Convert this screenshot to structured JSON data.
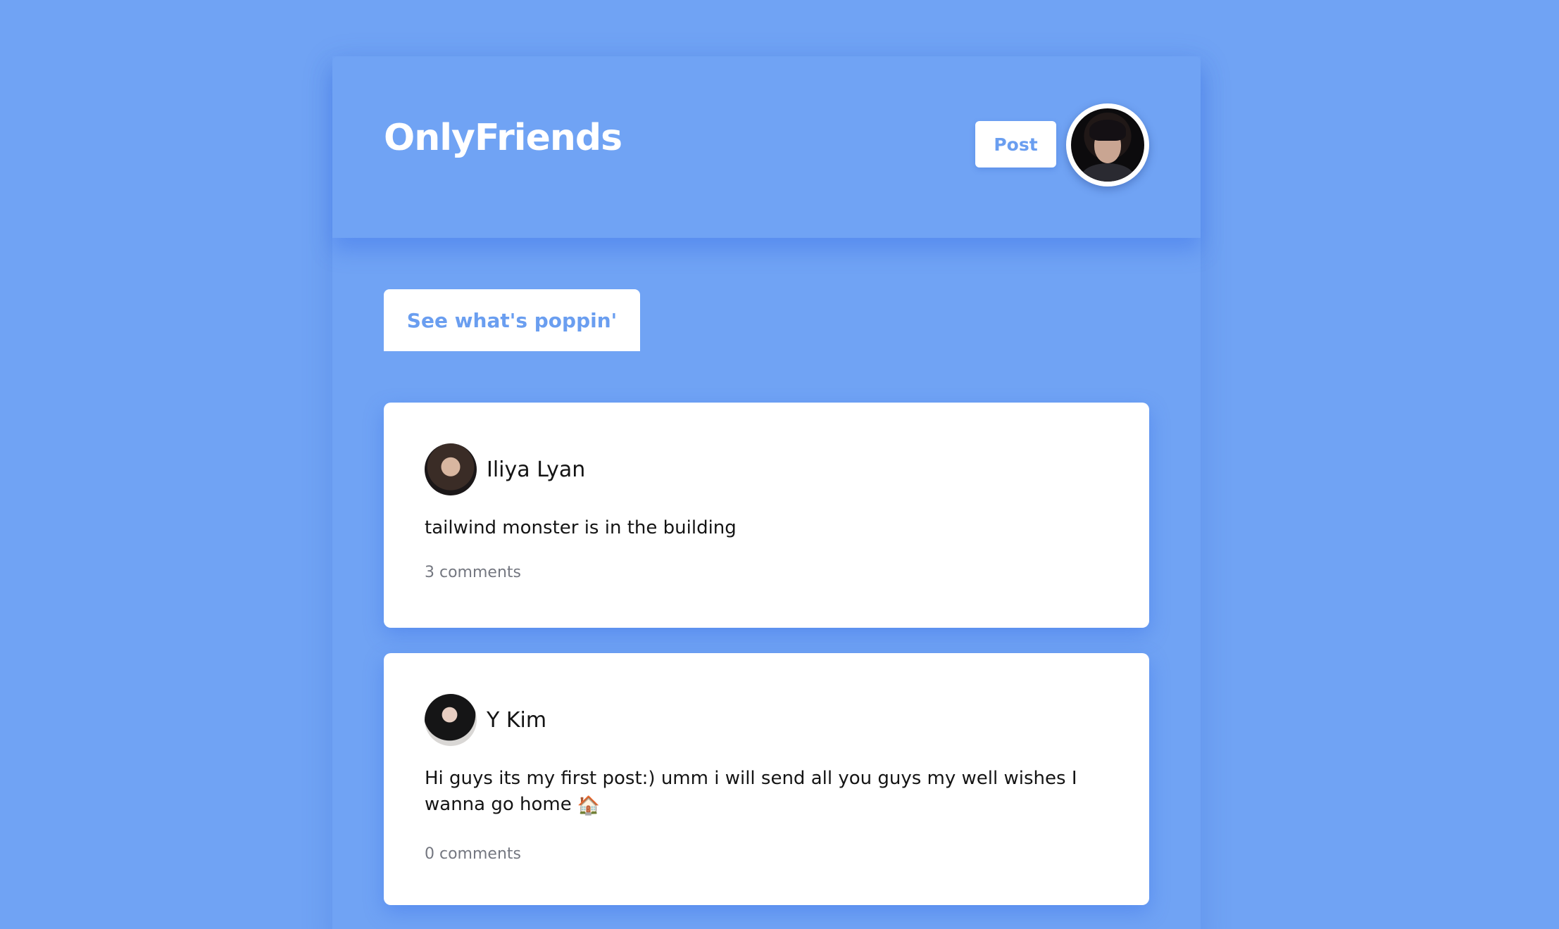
{
  "header": {
    "logo": "OnlyFriends",
    "post_button": "Post",
    "profile_avatar_icon": "user-avatar-icon"
  },
  "tabs": [
    {
      "label": "See what's poppin'"
    }
  ],
  "posts": [
    {
      "author": "Iliya Lyan",
      "text": "tailwind monster is in the building",
      "comments": "3 comments"
    },
    {
      "author": "Y Kim",
      "text": "Hi guys its my first post:) umm i will send all you guys my well wishes I wanna go home",
      "emoji": "🏠",
      "comments": "0 comments"
    }
  ],
  "colors": {
    "background": "#70a3f4",
    "accent": "#6a9ef0",
    "card": "#ffffff",
    "text": "#141414",
    "muted": "#747780"
  }
}
